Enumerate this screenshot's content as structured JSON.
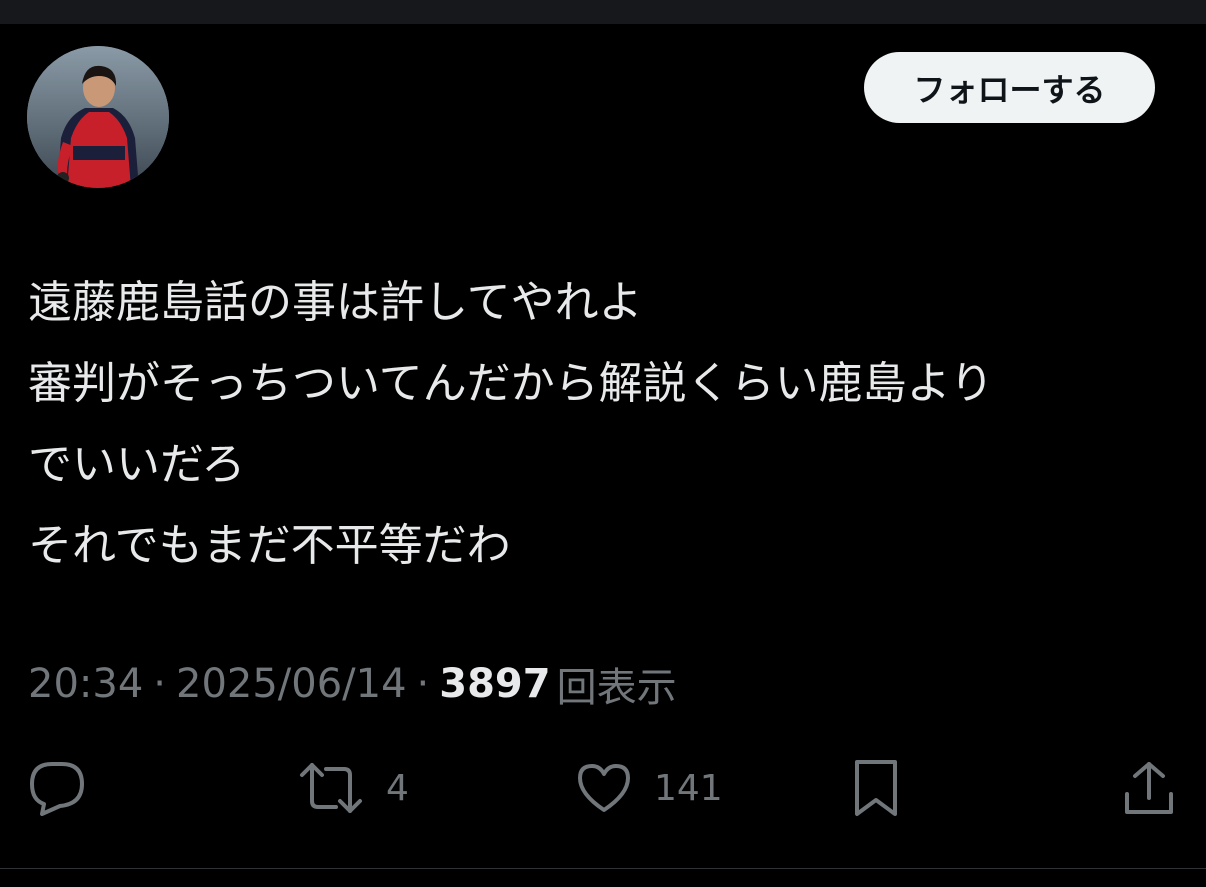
{
  "tweet": {
    "follow_label": "フォローする",
    "text_lines": [
      "遠藤鹿島話の事は許してやれよ",
      "審判がそっちついてんだから解説くらい鹿島より",
      "でいいだろ",
      "それでもまだ不平等だわ"
    ],
    "time": "20:34",
    "date": "2025/06/14",
    "views_count": "3897",
    "views_label": "回表示",
    "separator": "·"
  },
  "actions": {
    "reply": {
      "icon": "reply-icon"
    },
    "retweet": {
      "icon": "retweet-icon",
      "count": "4"
    },
    "like": {
      "icon": "heart-icon",
      "count": "141"
    },
    "bookmark": {
      "icon": "bookmark-icon"
    },
    "share": {
      "icon": "share-icon"
    }
  },
  "colors": {
    "background": "#000000",
    "text": "#e7e9ea",
    "muted": "#71767b",
    "button_bg": "#eff3f4",
    "button_text": "#0f1419"
  }
}
